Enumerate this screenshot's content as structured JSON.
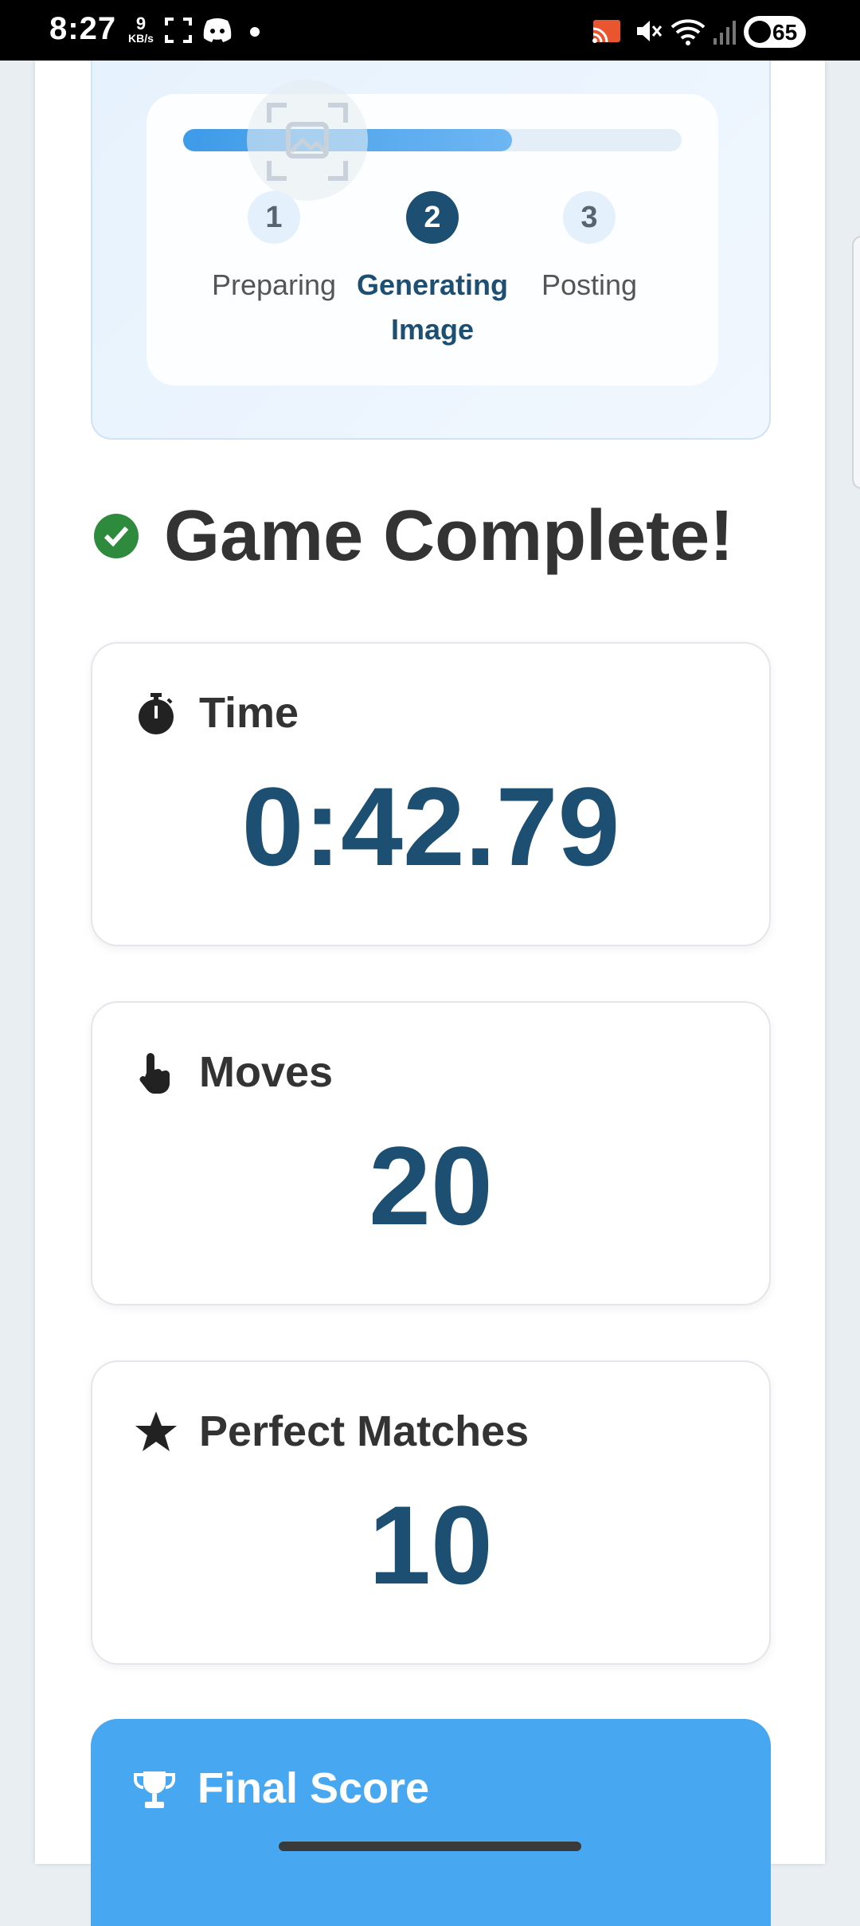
{
  "status_bar": {
    "time": "8:27",
    "net_speed_value": "9",
    "net_speed_unit": "KB/s",
    "battery": "65"
  },
  "progress": {
    "fraction_complete": 0.66,
    "steps": [
      {
        "number": "1",
        "label": "Preparing",
        "active": false
      },
      {
        "number": "2",
        "label": "Generating Image",
        "active": true
      },
      {
        "number": "3",
        "label": "Posting",
        "active": false
      }
    ]
  },
  "result": {
    "title": "Game Complete!",
    "stats": [
      {
        "label": "Time",
        "value": "0:42.79",
        "icon": "stopwatch-icon"
      },
      {
        "label": "Moves",
        "value": "20",
        "icon": "pointer-hand-icon"
      },
      {
        "label": "Perfect Matches",
        "value": "10",
        "icon": "star-icon"
      }
    ],
    "final_score_label": "Final Score"
  },
  "colors": {
    "accent": "#1d4f73",
    "success": "#2e8b3e",
    "final_card": "#47a7f0"
  }
}
